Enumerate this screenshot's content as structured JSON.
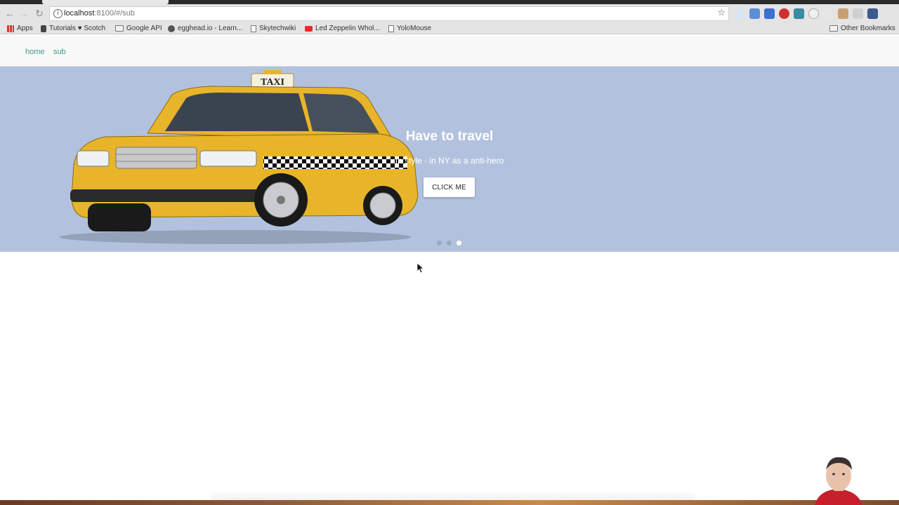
{
  "browser": {
    "url_host": "localhost",
    "url_path": ":8100/#/sub",
    "bookmarks": [
      {
        "label": "Apps",
        "icon": "apps-icon"
      },
      {
        "label": "Tutorials ♥ Scotch",
        "icon": "bookmark-icon"
      },
      {
        "label": "Google API",
        "icon": "folder-icon"
      },
      {
        "label": "egghead.io - Learn...",
        "icon": "github-icon"
      },
      {
        "label": "Skytechwiki",
        "icon": "page-icon"
      },
      {
        "label": "Led Zeppelin Whol...",
        "icon": "youtube-icon"
      },
      {
        "label": "YoloMouse",
        "icon": "page-icon"
      }
    ],
    "other_bookmarks": "Other Bookmarks"
  },
  "app": {
    "nav": [
      {
        "label": "home"
      },
      {
        "label": "sub"
      }
    ]
  },
  "hero": {
    "title": "Have to travel",
    "subtitle": "In style - in NY as a anti-hero",
    "button_label": "CLICK ME",
    "slide_count": 3,
    "active_slide": 3,
    "background_color": "#b2c2de"
  },
  "colors": {
    "link": "#3d9a8e",
    "taxi_yellow": "#e8b52a"
  }
}
